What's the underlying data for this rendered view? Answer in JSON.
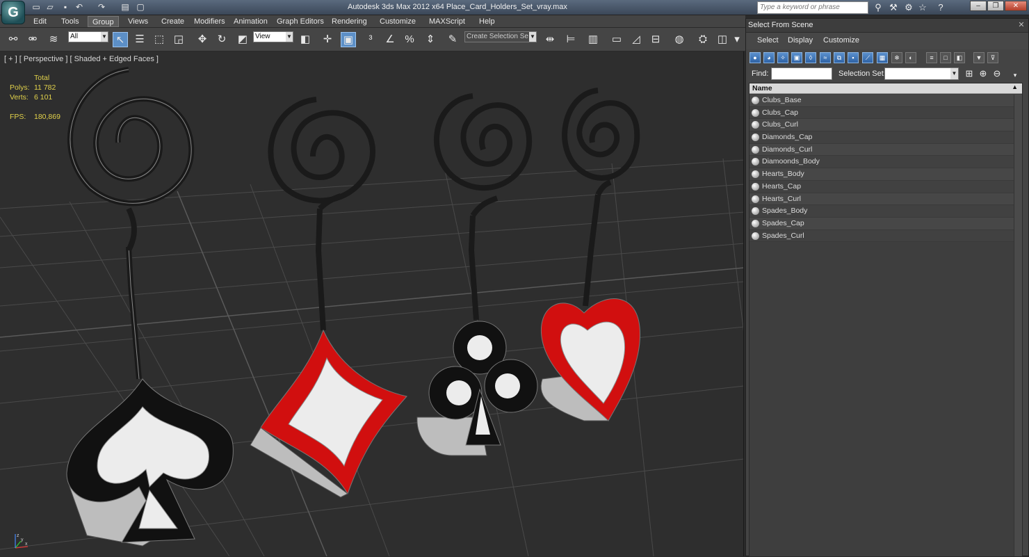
{
  "app": {
    "title": "Autodesk 3ds Max  2012 x64      Place_Card_Holders_Set_vray.max",
    "logo_glyph": "G",
    "search_placeholder": "Type a keyword or phrase"
  },
  "menubar": [
    "Edit",
    "Tools",
    "Group",
    "Views",
    "Create",
    "Modifiers",
    "Animation",
    "Graph Editors",
    "Rendering",
    "Customize",
    "MAXScript",
    "Help"
  ],
  "active_menu": "Group",
  "toolbar": {
    "filter_value": "All",
    "coord_value": "View",
    "selection_set_placeholder": "Create Selection Se"
  },
  "viewport": {
    "label": "[ + ] [ Perspective ] [ Shaded + Edged Faces ]",
    "stats": {
      "total_label": "Total",
      "polys_label": "Polys:",
      "polys_value": "11 782",
      "verts_label": "Verts:",
      "verts_value": "6 101",
      "fps_label": "FPS:",
      "fps_value": "180,869"
    },
    "axis": {
      "x": "x",
      "y": "y",
      "z": "z"
    }
  },
  "dialog": {
    "title": "Select From Scene",
    "menu": [
      "Select",
      "Display",
      "Customize"
    ],
    "find_label": "Find:",
    "find_value": "",
    "selection_set_label": "Selection Set:",
    "list_header": "Name",
    "objects": [
      "Clubs_Base",
      "Clubs_Cap",
      "Clubs_Curl",
      "Diamonds_Cap",
      "Diamonds_Curl",
      "Diamoonds_Body",
      "Hearts_Body",
      "Hearts_Cap",
      "Hearts_Curl",
      "Spades_Body",
      "Spades_Cap",
      "Spades_Curl"
    ]
  },
  "colors": {
    "viewport_bg": "#2e2e2e",
    "stats_text": "#e2d24b",
    "selection_blue": "#5c8fc7",
    "suit_red": "#d10f0f"
  }
}
